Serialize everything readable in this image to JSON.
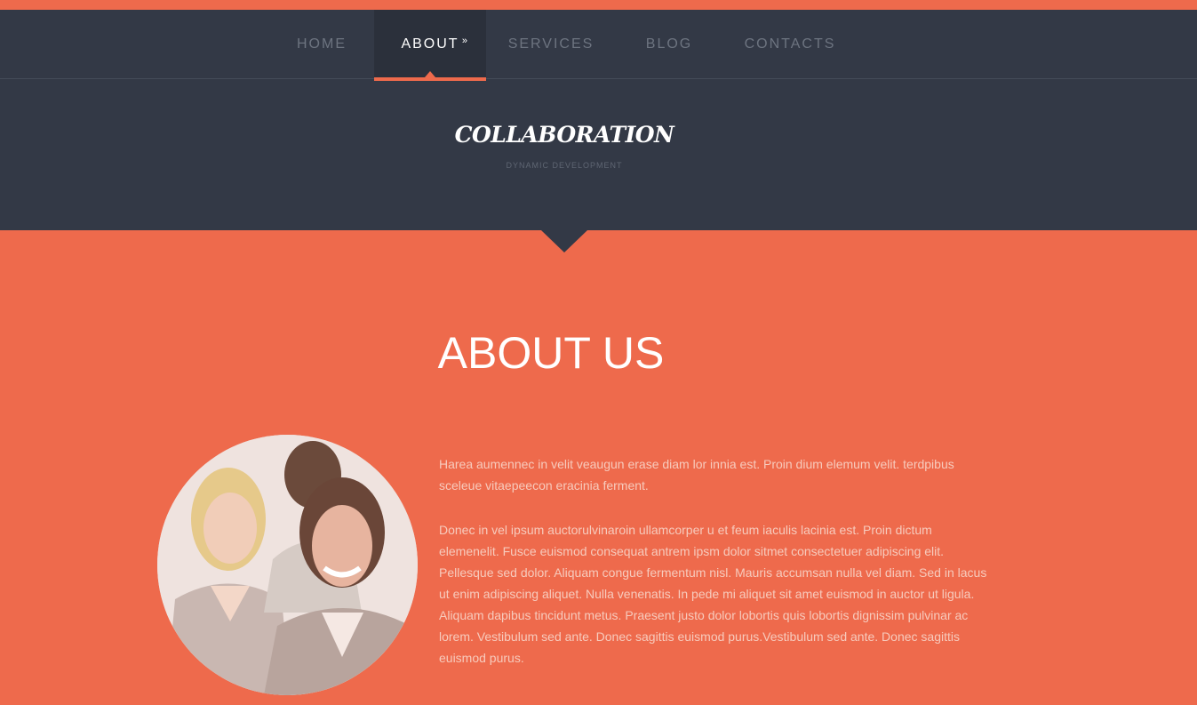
{
  "colors": {
    "accent": "#ee6a4c",
    "header_bg": "#333946",
    "nav_active_bg": "#2b303b",
    "nav_text": "#6d7480"
  },
  "nav": {
    "items": [
      {
        "label": "HOME",
        "active": false
      },
      {
        "label": "ABOUT",
        "active": true,
        "marker": "»"
      },
      {
        "label": "SERVICES",
        "active": false
      },
      {
        "label": "BLOG",
        "active": false
      },
      {
        "label": "CONTACTS",
        "active": false
      }
    ]
  },
  "brand": {
    "logo_text": "COLLABORATION",
    "tagline": "DYNAMIC DEVELOPMENT"
  },
  "about": {
    "title": "ABOUT US",
    "image_icon": "team-photo",
    "paragraphs": [
      "Harea aumennec in velit veaugun erase diam lor innia est. Proin dium elemum velit. terdpibus sceleue vitaepeecon eracinia ferment.",
      "Donec in vel ipsum auctorulvinaroin ullamcorper u et feum iaculis lacinia est. Proin dictum elemenelit. Fusce euismod consequat antrem ipsm dolor sitmet consectetuer adipiscing elit. Pellesque sed dolor. Aliquam congue fermentum nisl. Mauris accumsan nulla vel diam. Sed in lacus ut enim adipiscing aliquet. Nulla venenatis. In pede mi aliquet sit amet euismod in auctor ut ligula. Aliquam dapibus tincidunt metus. Praesent justo dolor lobortis quis lobortis dignissim pulvinar ac lorem. Vestibulum sed ante. Donec sagittis euismod purus.Vestibulum sed ante. Donec sagittis euismod purus."
    ]
  }
}
